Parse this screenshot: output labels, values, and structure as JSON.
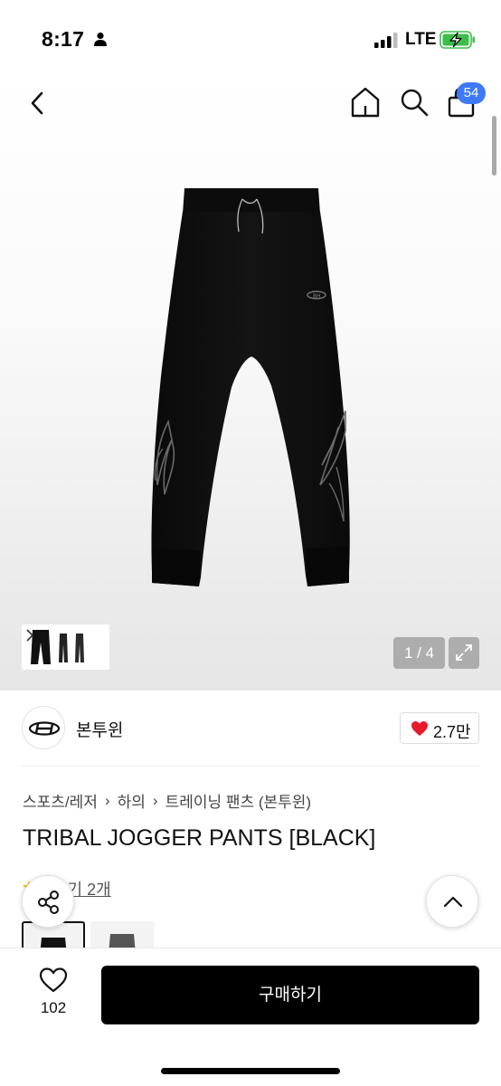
{
  "status_bar": {
    "time": "8:17",
    "network": "LTE"
  },
  "nav": {
    "cart_count": "54"
  },
  "gallery": {
    "page_counter": "1 / 4"
  },
  "brand": {
    "name": "본투윈",
    "likes": "2.7만"
  },
  "breadcrumb": [
    "스포츠/레저",
    "하의",
    "트레이닝 팬츠 (본투윈)"
  ],
  "product": {
    "title": "TRIBAL JOGGER PANTS [BLACK]",
    "reviews": "후기 2개"
  },
  "bottom_bar": {
    "wish_count": "102",
    "buy_label": "구매하기"
  },
  "colors": {
    "accent_blue": "#3f79f5",
    "like_red": "#e8192c",
    "buy_button": "#000000"
  }
}
